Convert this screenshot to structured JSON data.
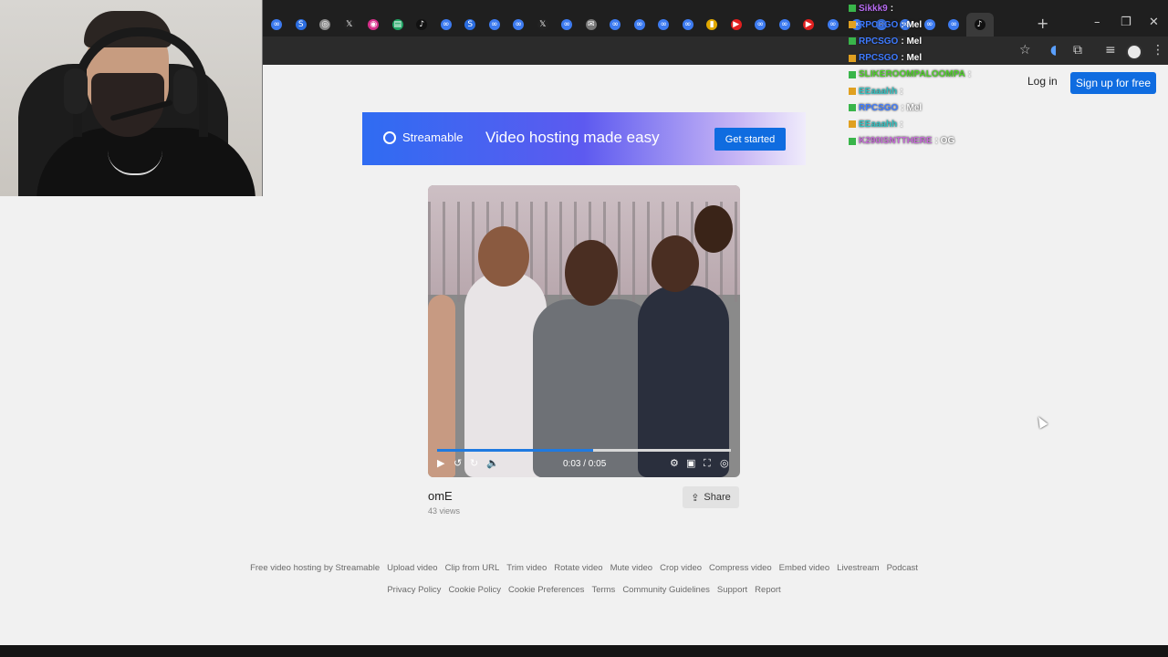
{
  "browser": {
    "tabs_favicons": [
      "ring",
      "S",
      "globe",
      "X",
      "insta",
      "doc",
      "tiktok",
      "ring",
      "S",
      "ring",
      "ring",
      "X",
      "ring",
      "mail",
      "ring",
      "ring",
      "ring",
      "ring",
      "chart",
      "yt",
      "ring",
      "ring",
      "yt",
      "ring",
      "ring",
      "ring",
      "ring",
      "ring",
      "ring",
      "tiktok"
    ],
    "toolbar_icons": [
      "star-icon",
      "speaker-icon",
      "extension-icon",
      "menu-icon",
      "profile-icon",
      "more-icon"
    ]
  },
  "chat": [
    {
      "user": "Sikkk9",
      "msg": "",
      "color": "#b86cf2"
    },
    {
      "user": "RPCSGO",
      "msg": "Mel",
      "color": "#3f7bff"
    },
    {
      "user": "RPCSGO",
      "msg": "Mel",
      "color": "#3f7bff"
    },
    {
      "user": "RPCSGO",
      "msg": "Mel",
      "color": "#3f7bff"
    },
    {
      "user": "SLIKEROOMPALOOMPA",
      "msg": "",
      "color": "#4fcf2a"
    },
    {
      "user": "EEaaahh",
      "msg": "",
      "color": "#31c0c0"
    },
    {
      "user": "RPCSGO",
      "msg": "Mel",
      "color": "#3f7bff"
    },
    {
      "user": "EEaaahh",
      "msg": "",
      "color": "#31c0c0"
    },
    {
      "user": "K290ISNTTHERE",
      "msg": "OG",
      "color": "#c56bd6"
    }
  ],
  "header": {
    "login": "Log in",
    "signup": "Sign up for free"
  },
  "banner": {
    "logo": "Streamable",
    "tagline": "Video hosting made easy",
    "cta": "Get started"
  },
  "player": {
    "time": "0:03 / 0:05",
    "progress": 0.53
  },
  "video": {
    "title": "omE",
    "views": "43 views",
    "share": "Share"
  },
  "footer": {
    "row1": [
      "Free video hosting by Streamable",
      "Upload video",
      "Clip from URL",
      "Trim video",
      "Rotate video",
      "Mute video",
      "Crop video",
      "Compress video",
      "Embed video",
      "Livestream",
      "Podcast"
    ],
    "row2": [
      "Privacy Policy",
      "Cookie Policy",
      "Cookie Preferences",
      "Terms",
      "Community Guidelines",
      "Support",
      "Report"
    ]
  }
}
